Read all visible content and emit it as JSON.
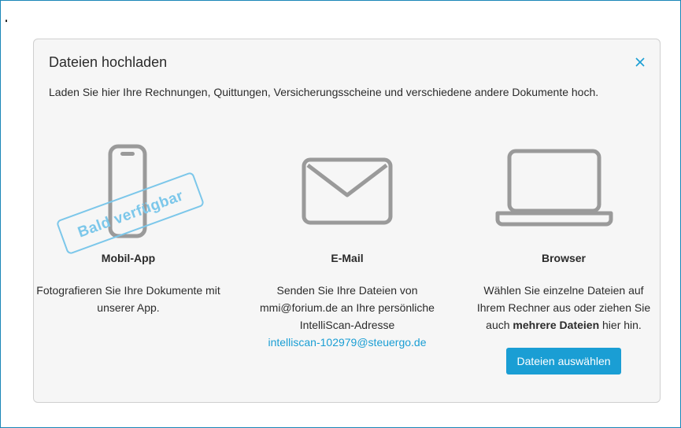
{
  "modal": {
    "title": "Dateien hochladen",
    "intro": "Laden Sie hier Ihre Rechnungen, Quittungen, Versicherungsscheine und verschiedene andere Dokumente hoch."
  },
  "options": {
    "mobile": {
      "title": "Mobil-App",
      "stamp": "Bald verfügbar",
      "text": "Fotografieren Sie Ihre Dokumente mit unserer App."
    },
    "email": {
      "title": "E-Mail",
      "text": "Senden Sie Ihre Dateien von mmi@forium.de an Ihre persönliche IntelliScan-Adresse",
      "address": "intelliscan-102979@steuergo.de"
    },
    "browser": {
      "title": "Browser",
      "text_before": "Wählen Sie einzelne Dateien auf Ihrem Rechner aus oder ziehen Sie auch",
      "text_bold": "mehrere Dateien",
      "text_after": "hier hin.",
      "button": "Dateien auswählen"
    }
  },
  "colors": {
    "accent": "#1a9ed4",
    "stamp": "#7cc7ea",
    "icon": "#9a9a9a"
  }
}
